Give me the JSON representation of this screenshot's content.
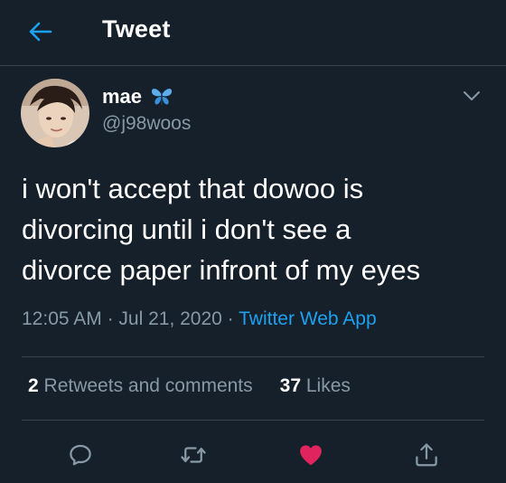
{
  "header": {
    "title": "Tweet",
    "back_icon": "back-arrow-icon"
  },
  "author": {
    "display_name": "mae",
    "name_emoji": "butterfly",
    "handle": "@j98woos",
    "avatar": "profile-photo"
  },
  "tweet": {
    "lines": [
      "i won't accept that dowoo is",
      "divorcing until i don't see a",
      "divorce paper infront of my eyes"
    ]
  },
  "meta": {
    "time": "12:05 AM",
    "sep1": " · ",
    "date": "Jul 21, 2020",
    "sep2": " · ",
    "source": "Twitter Web App"
  },
  "stats": {
    "retweets_count": "2",
    "retweets_label": "Retweets and comments",
    "likes_count": "37",
    "likes_label": "Likes"
  },
  "actions": {
    "reply_icon": "reply-icon",
    "retweet_icon": "retweet-icon",
    "like_icon": "heart-icon",
    "like_state": "liked",
    "share_icon": "share-icon"
  },
  "colors": {
    "background": "#15202b",
    "accent": "#1da1f2",
    "like": "#e0245e",
    "secondary_text": "#8899a6",
    "divider": "#38444d"
  }
}
